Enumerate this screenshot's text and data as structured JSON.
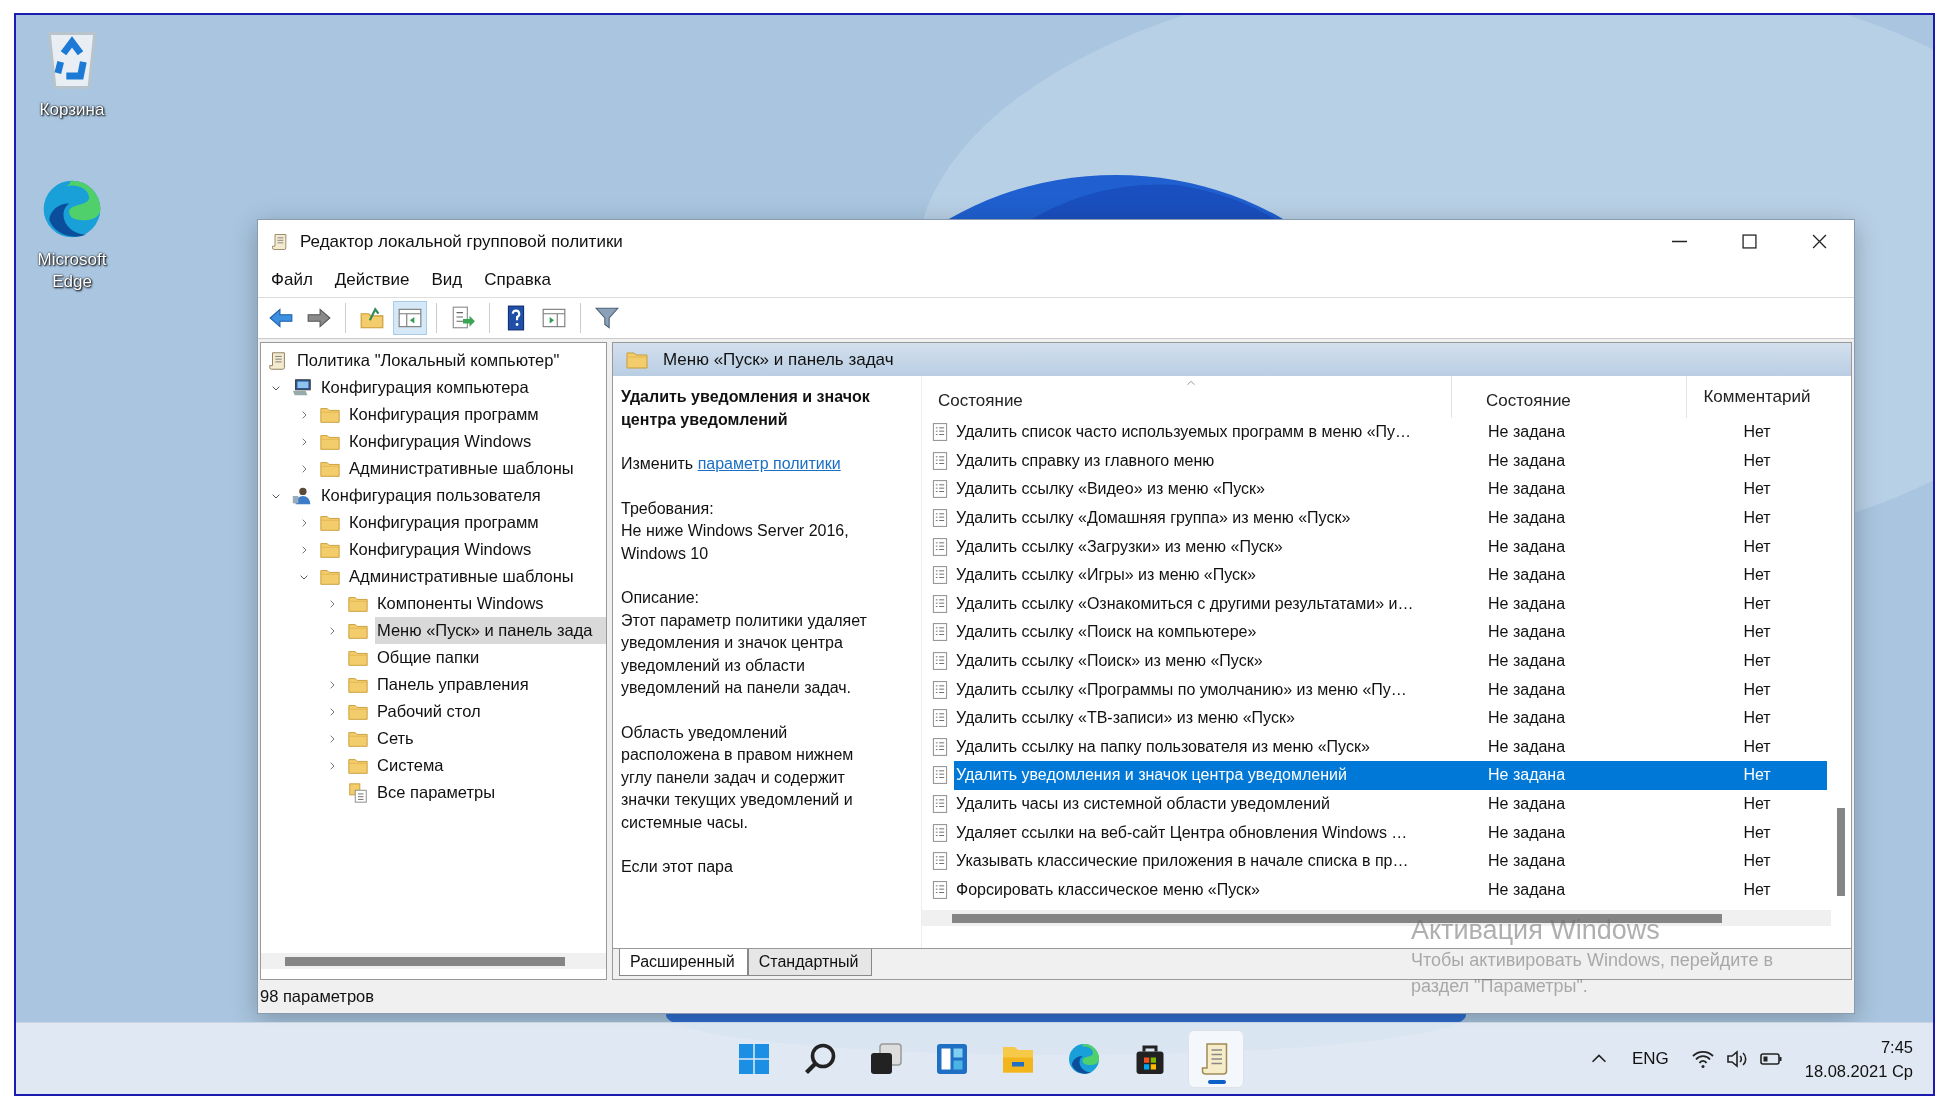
{
  "desktop": {
    "icons": [
      {
        "label": "Корзина",
        "kind": "recycle"
      },
      {
        "label": "Microsoft Edge",
        "kind": "edge"
      }
    ]
  },
  "window": {
    "title": "Редактор локальной групповой политики",
    "menu": [
      "Файл",
      "Действие",
      "Вид",
      "Справка"
    ],
    "toolbar": [
      {
        "kind": "back",
        "selected": false
      },
      {
        "kind": "forward",
        "selected": false
      },
      {
        "kind": "sep"
      },
      {
        "kind": "up",
        "selected": false
      },
      {
        "kind": "tree",
        "selected": true
      },
      {
        "kind": "sep"
      },
      {
        "kind": "export",
        "selected": false
      },
      {
        "kind": "sep"
      },
      {
        "kind": "help",
        "selected": false
      },
      {
        "kind": "action",
        "selected": false
      },
      {
        "kind": "sep"
      },
      {
        "kind": "filter",
        "selected": false
      }
    ],
    "tree": {
      "items": [
        {
          "label": "Политика \"Локальный компьютер\"",
          "kind": "policy",
          "selected": false,
          "children": [
            {
              "label": "Конфигурация компьютера",
              "kind": "computer",
              "expanded": true,
              "selected": false,
              "children": [
                {
                  "label": "Конфигурация программ",
                  "kind": "folder",
                  "expanded": false,
                  "selected": false
                },
                {
                  "label": "Конфигурация Windows",
                  "kind": "folder",
                  "expanded": false,
                  "selected": false
                },
                {
                  "label": "Административные шаблоны",
                  "kind": "folder",
                  "expanded": false,
                  "selected": false
                }
              ]
            },
            {
              "label": "Конфигурация пользователя",
              "kind": "user",
              "expanded": true,
              "selected": false,
              "children": [
                {
                  "label": "Конфигурация программ",
                  "kind": "folder",
                  "expanded": false,
                  "selected": false
                },
                {
                  "label": "Конфигурация Windows",
                  "kind": "folder",
                  "expanded": false,
                  "selected": false
                },
                {
                  "label": "Административные шаблоны",
                  "kind": "folder",
                  "expanded": true,
                  "selected": false,
                  "children": [
                    {
                      "label": "Компоненты Windows",
                      "kind": "folder",
                      "expanded": false,
                      "selected": false
                    },
                    {
                      "label": "Меню «Пуск» и панель зада",
                      "kind": "folder",
                      "expanded": false,
                      "selected": true
                    },
                    {
                      "label": "Общие папки",
                      "kind": "folder",
                      "selected": false
                    },
                    {
                      "label": "Панель управления",
                      "kind": "folder",
                      "expanded": false,
                      "selected": false
                    },
                    {
                      "label": "Рабочий стол",
                      "kind": "folder",
                      "expanded": false,
                      "selected": false
                    },
                    {
                      "label": "Сеть",
                      "kind": "folder",
                      "expanded": false,
                      "selected": false
                    },
                    {
                      "label": "Система",
                      "kind": "folder",
                      "expanded": false,
                      "selected": false
                    },
                    {
                      "label": "Все параметры",
                      "kind": "settings",
                      "selected": false
                    }
                  ]
                }
              ]
            }
          ]
        }
      ]
    },
    "panel": {
      "header": "Меню «Пуск» и панель задач",
      "details": {
        "title": "Удалить уведомления и значок центра уведомлений",
        "edit_prefix": "Изменить",
        "edit_link": "параметр политики",
        "requirements_label": "Требования:",
        "requirements": "Не ниже Windows Server 2016, Windows 10",
        "description_label": "Описание:",
        "paragraphs": [
          "Этот параметр политики удаляет уведомления и значок центра уведомлений из области уведомлений на панели задач.",
          "Область уведомлений расположена в правом нижнем углу панели задач и содержит значки текущих уведомлений и системные часы.",
          "Если этот пара"
        ]
      },
      "table": {
        "columns": [
          {
            "label": "Состояние",
            "sorted": true
          },
          {
            "label": "Состояние",
            "sorted": false
          },
          {
            "label": "Комментарий",
            "sorted": false
          }
        ],
        "rows": [
          {
            "name": "Удалить список часто используемых программ в меню «Пу…",
            "state": "Не задана",
            "comment": "Нет",
            "selected": false
          },
          {
            "name": "Удалить справку из главного меню",
            "state": "Не задана",
            "comment": "Нет",
            "selected": false
          },
          {
            "name": "Удалить ссылку «Видео» из меню «Пуск»",
            "state": "Не задана",
            "comment": "Нет",
            "selected": false
          },
          {
            "name": "Удалить ссылку «Домашняя группа» из меню «Пуск»",
            "state": "Не задана",
            "comment": "Нет",
            "selected": false
          },
          {
            "name": "Удалить ссылку «Загрузки» из меню «Пуск»",
            "state": "Не задана",
            "comment": "Нет",
            "selected": false
          },
          {
            "name": "Удалить ссылку «Игры» из меню «Пуск»",
            "state": "Не задана",
            "comment": "Нет",
            "selected": false
          },
          {
            "name": "Удалить ссылку «Ознакомиться с другими результатами» и…",
            "state": "Не задана",
            "comment": "Нет",
            "selected": false
          },
          {
            "name": "Удалить ссылку «Поиск на компьютере»",
            "state": "Не задана",
            "comment": "Нет",
            "selected": false
          },
          {
            "name": "Удалить ссылку «Поиск» из меню «Пуск»",
            "state": "Не задана",
            "comment": "Нет",
            "selected": false
          },
          {
            "name": "Удалить ссылку «Программы по умолчанию» из меню «Пу…",
            "state": "Не задана",
            "comment": "Нет",
            "selected": false
          },
          {
            "name": "Удалить ссылку «ТВ-записи» из меню «Пуск»",
            "state": "Не задана",
            "comment": "Нет",
            "selected": false
          },
          {
            "name": "Удалить ссылку на папку пользователя из меню «Пуск»",
            "state": "Не задана",
            "comment": "Нет",
            "selected": false
          },
          {
            "name": "Удалить уведомления и значок центра уведомлений",
            "state": "Не задана",
            "comment": "Нет",
            "selected": true
          },
          {
            "name": "Удалить часы из системной области уведомлений",
            "state": "Не задана",
            "comment": "Нет",
            "selected": false
          },
          {
            "name": "Удаляет ссылки на веб-сайт Центра обновления Windows …",
            "state": "Не задана",
            "comment": "Нет",
            "selected": false
          },
          {
            "name": "Указывать классические приложения в начале списка в пр…",
            "state": "Не задана",
            "comment": "Нет",
            "selected": false
          },
          {
            "name": "Форсировать классическое меню «Пуск»",
            "state": "Не задана",
            "comment": "Нет",
            "selected": false
          }
        ]
      },
      "tabs": [
        {
          "label": "Расширенный",
          "selected": true
        },
        {
          "label": "Стандартный",
          "selected": false
        }
      ]
    },
    "status_bar": "98 параметров"
  },
  "activation": {
    "title": "Активация Windows",
    "lines": [
      "Чтобы активировать Windows, перейдите в",
      "раздел \"Параметры\"."
    ]
  },
  "taskbar": {
    "apps": [
      {
        "kind": "start",
        "active": false
      },
      {
        "kind": "search",
        "active": false
      },
      {
        "kind": "taskview",
        "active": false
      },
      {
        "kind": "widgets",
        "active": false
      },
      {
        "kind": "explorer",
        "active": false
      },
      {
        "kind": "edge",
        "active": false
      },
      {
        "kind": "store",
        "active": false
      },
      {
        "kind": "gpedit",
        "active": true
      }
    ],
    "language": "ENG",
    "time": "7:45",
    "date": "18.08.2021 Ср"
  }
}
